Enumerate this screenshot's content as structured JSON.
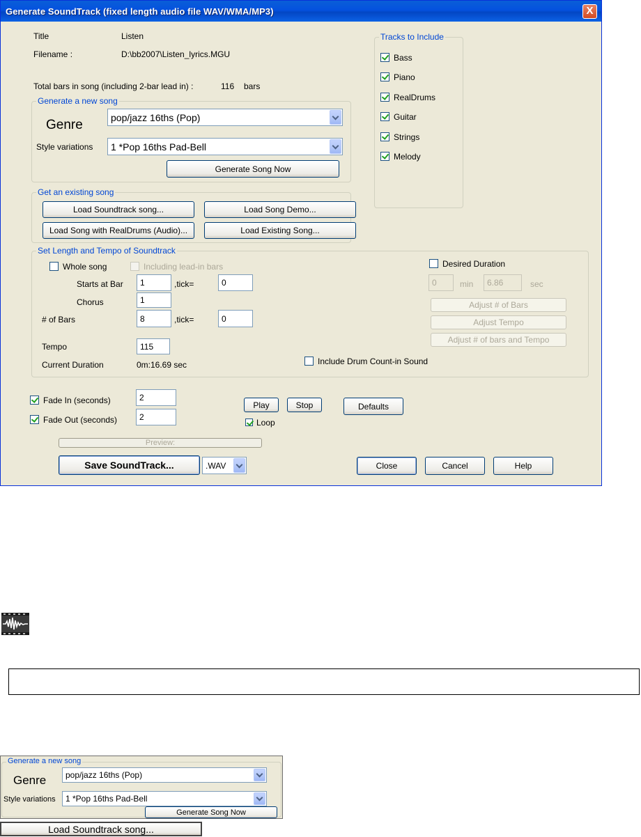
{
  "window": {
    "title": "Generate SoundTrack (fixed length audio file WAV/WMA/MP3)",
    "close_glyph": "X"
  },
  "info": {
    "title_label": "Title",
    "title_value": "Listen",
    "filename_label": "Filename :",
    "filename_value": "D:\\bb2007\\Listen_lyrics.MGU",
    "total_bars_label": "Total bars in song (including 2-bar lead in) :",
    "total_bars_value": "116",
    "total_bars_unit": "bars"
  },
  "generate_group": {
    "title": "Generate a new song",
    "genre_label": "Genre",
    "genre_value": "pop/jazz 16ths (Pop)",
    "style_label": "Style variations",
    "style_value": "1 *Pop 16ths Pad-Bell",
    "generate_button": "Generate Song Now"
  },
  "existing_group": {
    "title": "Get an existing song",
    "load_soundtrack": "Load Soundtrack song...",
    "load_demo": "Load Song Demo...",
    "load_realdrums": "Load Song with RealDrums (Audio)...",
    "load_existing": "Load Existing Song..."
  },
  "tracks_group": {
    "title": "Tracks to Include",
    "items": [
      {
        "label": "Bass",
        "checked": true
      },
      {
        "label": "Piano",
        "checked": true
      },
      {
        "label": "RealDrums",
        "checked": true
      },
      {
        "label": "Guitar",
        "checked": true
      },
      {
        "label": "Strings",
        "checked": true
      },
      {
        "label": "Melody",
        "checked": true
      }
    ]
  },
  "length_group": {
    "title": "Set Length and Tempo of Soundtrack",
    "whole_song": "Whole song",
    "including_leadin": "Including lead-in bars",
    "starts_at_bar_label": "Starts at Bar",
    "starts_at_bar_value": "1",
    "tick_label": ",tick=",
    "start_tick_value": "0",
    "chorus_label": "Chorus",
    "chorus_value": "1",
    "bars_label": "# of Bars",
    "bars_value": "8",
    "bars_tick_value": "0",
    "tempo_label": "Tempo",
    "tempo_value": "115",
    "current_duration_label": "Current Duration",
    "current_duration_value": "0m:16.69 sec",
    "desired_duration": "Desired Duration",
    "min_value": "0",
    "min_label": "min",
    "sec_value": "6.86",
    "sec_label": "sec",
    "adjust_bars": "Adjust # of Bars",
    "adjust_tempo": "Adjust Tempo",
    "adjust_both": "Adjust # of bars and Tempo",
    "drum_countin": "Include Drum Count-in Sound"
  },
  "fade": {
    "fade_in_label": "Fade In (seconds)",
    "fade_in_value": "2",
    "fade_out_label": "Fade Out  (seconds)",
    "fade_out_value": "2"
  },
  "playback": {
    "play": "Play",
    "stop": "Stop",
    "loop": "Loop",
    "defaults": "Defaults",
    "preview": "Preview:"
  },
  "footer": {
    "save": "Save SoundTrack...",
    "format": ".WAV",
    "close": "Close",
    "cancel": "Cancel",
    "help": "Help"
  },
  "zoom": {
    "title": "Generate a new song",
    "genre_label": "Genre",
    "genre_value": "pop/jazz 16ths (Pop)",
    "style_label": "Style variations",
    "style_value": "1 *Pop 16ths Pad-Bell",
    "generate_button": "Generate Song Now",
    "load_button": "Load Soundtrack song..."
  },
  "icons": {
    "waveform": "waveform-icon"
  }
}
